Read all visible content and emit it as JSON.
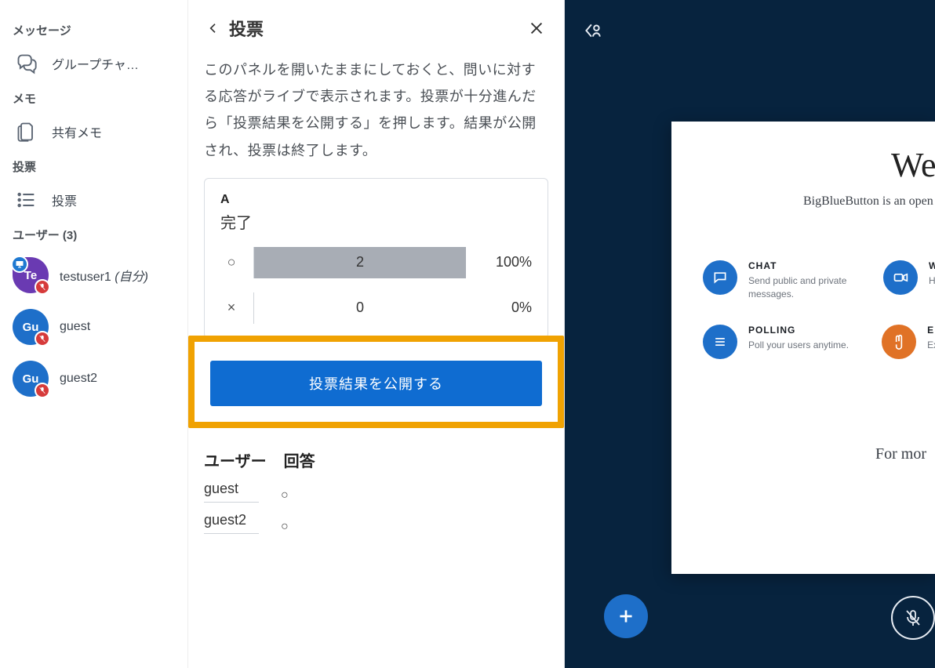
{
  "sidebar": {
    "messages_heading": "メッセージ",
    "group_chat_label": "グループチャ…",
    "notes_heading": "メモ",
    "shared_notes_label": "共有メモ",
    "poll_heading": "投票",
    "poll_label": "投票",
    "users_heading": "ユーザー (3)"
  },
  "users": [
    {
      "initials": "Te",
      "name": "testuser1",
      "suffix": "(自分)",
      "role": "moderator",
      "muted": true,
      "presenter": true
    },
    {
      "initials": "Gu",
      "name": "guest",
      "suffix": "",
      "role": "viewer",
      "muted": true,
      "presenter": false
    },
    {
      "initials": "Gu",
      "name": "guest2",
      "suffix": "",
      "role": "viewer",
      "muted": true,
      "presenter": false
    }
  ],
  "panel": {
    "title": "投票",
    "description": "このパネルを開いたままにしておくと、問いに対する応答がライブで表示されます。投票が十分進んだら「投票結果を公開する」を押します。結果が公開され、投票は終了します。",
    "question_letter": "A",
    "question_text": "完了",
    "options": [
      {
        "label": "○",
        "count": 2,
        "percent": "100%"
      },
      {
        "label": "×",
        "count": 0,
        "percent": "0%"
      }
    ],
    "publish_label": "投票結果を公開する",
    "responses_header_user": "ユーザー",
    "responses_header_answer": "回答",
    "responses": [
      {
        "user": "guest",
        "answer": "○"
      },
      {
        "user": "guest2",
        "answer": "○"
      }
    ]
  },
  "presentation": {
    "welcome_title": "Welcome",
    "welcome_sub": "BigBlueButton is an open",
    "features": [
      {
        "icon": "chat",
        "title": "CHAT",
        "desc": "Send public and private messages."
      },
      {
        "icon": "video",
        "title": "W",
        "desc": "H"
      },
      {
        "icon": "poll",
        "title": "POLLING",
        "desc": "Poll your users anytime."
      },
      {
        "icon": "hand",
        "title": "E",
        "desc": "Ex"
      }
    ],
    "more_text": "For mor"
  }
}
